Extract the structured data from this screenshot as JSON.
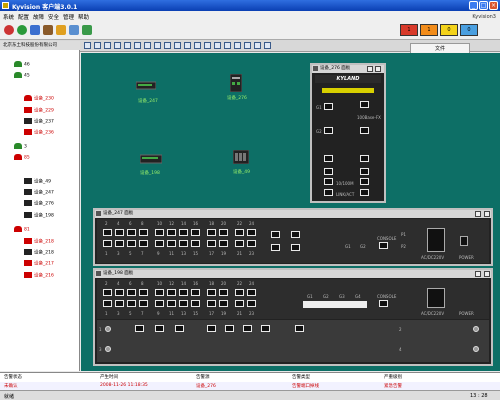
{
  "window": {
    "title": "Kyvision 客户端3.0.1",
    "minimize": "_",
    "maximize": "□",
    "close": "×"
  },
  "menu": [
    "系统",
    "配置",
    "故障",
    "安全",
    "管理",
    "帮助"
  ],
  "brand": "Kyvision3",
  "alarms": [
    {
      "count": "1",
      "color": "#d83a2a"
    },
    {
      "count": "1",
      "color": "#f28c1a"
    },
    {
      "count": "0",
      "color": "#f3d21a"
    },
    {
      "count": "0",
      "color": "#4a9fe0"
    }
  ],
  "file_tab": "文件",
  "tree": {
    "header": "北京东土科技股份有限公司",
    "items": [
      {
        "label": "46",
        "icon": "green",
        "red": false
      },
      {
        "label": "45",
        "icon": "green",
        "red": false
      },
      {
        "label": "设备_230",
        "icon": "red",
        "red": true
      },
      {
        "label": "设备_229",
        "icon": "devr",
        "red": true
      },
      {
        "label": "设备_237",
        "icon": "dev",
        "red": false
      },
      {
        "label": "设备_236",
        "icon": "devr",
        "red": true
      },
      {
        "label": "3",
        "icon": "green",
        "red": false
      },
      {
        "label": "85",
        "icon": "red",
        "red": true
      },
      {
        "label": "设备_49",
        "icon": "dev",
        "red": false
      },
      {
        "label": "设备_247",
        "icon": "dev",
        "red": false
      },
      {
        "label": "设备_276",
        "icon": "dev",
        "red": false
      },
      {
        "label": "设备_198",
        "icon": "dev",
        "red": false
      },
      {
        "label": "81",
        "icon": "red",
        "red": true
      },
      {
        "label": "设备_218",
        "icon": "devr",
        "red": true
      },
      {
        "label": "设备_218",
        "icon": "dev",
        "red": false
      },
      {
        "label": "设备_217",
        "icon": "devr",
        "red": true
      },
      {
        "label": "设备_216",
        "icon": "devr",
        "red": true
      }
    ]
  },
  "topology": {
    "nodes": [
      {
        "label": "设备_247"
      },
      {
        "label": "设备_276"
      },
      {
        "label": "设备_198"
      },
      {
        "label": "设备_49"
      }
    ]
  },
  "panel276": {
    "title": "设备_276 面板",
    "brand": "KYLAND",
    "ports": [
      "1",
      "2",
      "3",
      "4"
    ],
    "speed_label": "10/100M",
    "link_label": "LINK/ACT",
    "fx_label": "100Base-FX",
    "g1": "G1",
    "g2": "G2"
  },
  "panel247": {
    "title": "设备_247 面板",
    "top_nums": [
      "2",
      "4",
      "6",
      "8",
      "10",
      "12",
      "14",
      "16",
      "18",
      "20",
      "22",
      "24"
    ],
    "bottom_nums": [
      "1",
      "3",
      "5",
      "7",
      "9",
      "11",
      "13",
      "15",
      "17",
      "19",
      "21",
      "23"
    ],
    "g_labels": [
      "G1",
      "G2"
    ],
    "console": "CONSOLE",
    "power": "POWER",
    "p1": "P1",
    "p2": "P2",
    "ac": "AC/DC220V"
  },
  "panel198": {
    "title": "设备_198 面板",
    "top_nums": [
      "2",
      "4",
      "6",
      "8",
      "10",
      "12",
      "14",
      "16",
      "18",
      "20",
      "22",
      "24"
    ],
    "bottom_nums": [
      "1",
      "3",
      "5",
      "7",
      "9",
      "11",
      "13",
      "15",
      "17",
      "19",
      "21",
      "23"
    ],
    "g_labels": [
      "G1",
      "G2",
      "G3",
      "G4"
    ],
    "console": "CONSOLE",
    "power": "POWER",
    "ac": "AC/DC220V",
    "slot_nums": [
      "1",
      "2",
      "3",
      "4"
    ]
  },
  "alarm_panel": {
    "headers": [
      "告警状态",
      "产生时间",
      "告警源",
      "告警类型",
      "严重级别"
    ],
    "row": [
      "未确认",
      "2008-11-26 11:18:35",
      "设备_276",
      "告警端口掉线",
      "紧急告警"
    ]
  },
  "status": {
    "left": "就绪",
    "right": "13 : 28"
  }
}
